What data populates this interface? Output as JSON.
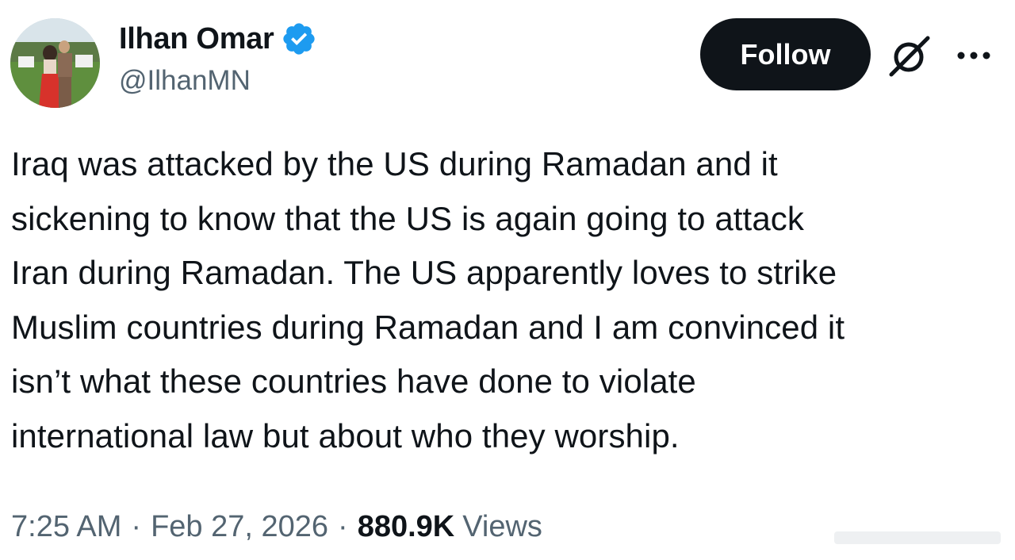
{
  "author": {
    "display_name": "Ilhan Omar",
    "handle": "@IlhanMN",
    "verified": true,
    "verified_color": "#1d9bf0"
  },
  "actions": {
    "follow_label": "Follow",
    "follow_bg": "#0f1419",
    "grok_icon": "grok-icon",
    "more_icon": "more-options-icon"
  },
  "tweet": {
    "text": "Iraq was attacked by the US during Ramadan and it\nsickening to know that the US is again going to attack\nIran during Ramadan.  The US apparently loves to strike\nMuslim countries during Ramadan and I am convinced it\nisn’t what these countries have done to violate\ninternational law but about who they worship."
  },
  "meta": {
    "time": "7:25 AM",
    "separator": "·",
    "date": "Feb 27, 2026",
    "views_count": "880.9K",
    "views_label": "Views"
  },
  "colors": {
    "text": "#0f1419",
    "secondary": "#536471",
    "background": "#ffffff"
  }
}
